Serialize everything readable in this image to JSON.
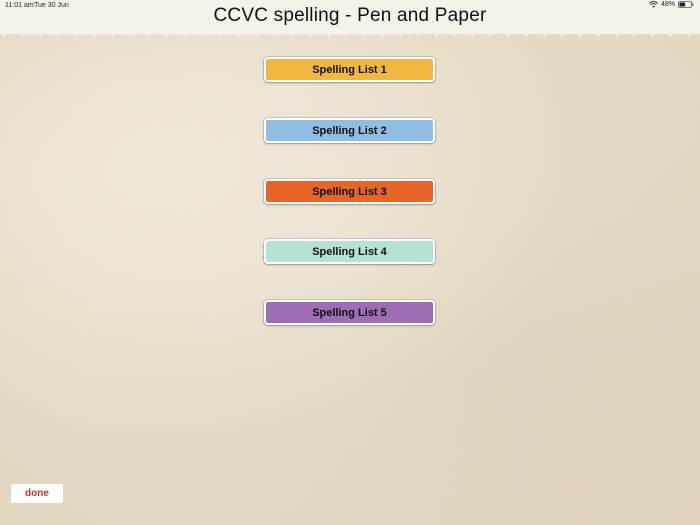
{
  "status_bar": {
    "time": "11:01 am",
    "date": "Tue 30 Jun",
    "battery": "48%",
    "wifi_icon": "wifi-icon",
    "battery_icon": "battery-icon"
  },
  "header": {
    "title": "CCVC spelling - Pen and Paper"
  },
  "spelling_lists": [
    {
      "label": "Spelling List 1",
      "color": "#f0b83f"
    },
    {
      "label": "Spelling List 2",
      "color": "#92bde3"
    },
    {
      "label": "Spelling List 3",
      "color": "#e8652a"
    },
    {
      "label": "Spelling List 4",
      "color": "#b6e2d3"
    },
    {
      "label": "Spelling List 5",
      "color": "#9d6db5"
    }
  ],
  "footer": {
    "done_label": "done",
    "done_color": "#c0392b"
  }
}
